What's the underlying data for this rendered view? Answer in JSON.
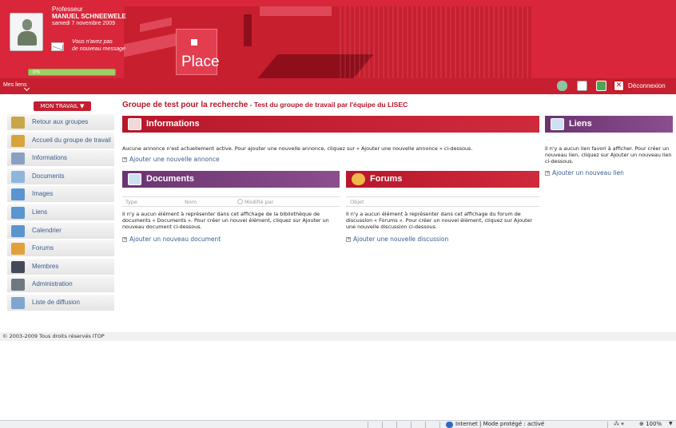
{
  "header": {
    "role": "Professeur",
    "username": "MANUEL SCHNEEWELE",
    "date": "samedi 7 novembre 2009",
    "messages_line1": "Vous n'avez pas",
    "messages_line2": "de nouveau message",
    "progress_label": "0%",
    "progress_fraction": 0,
    "brand": "Place",
    "my_links": "Mes liens",
    "logout": "Déconnexion",
    "icons": [
      "trash-icon",
      "edit-icon",
      "sync-icon",
      "close-icon"
    ]
  },
  "sidebar": {
    "work_menu": "MON TRAVAIL ▼",
    "items": [
      {
        "label": "Retour aux groupes",
        "icon": "back-groups-icon",
        "color": "#c9a64a"
      },
      {
        "label": "Accueil du groupe de travail",
        "icon": "home-icon",
        "color": "#d7a43a"
      },
      {
        "label": "Informations",
        "icon": "info-icon",
        "color": "#8aa0c0"
      },
      {
        "label": "Documents",
        "icon": "folder-icon",
        "color": "#8fb5da"
      },
      {
        "label": "Images",
        "icon": "images-icon",
        "color": "#5a95cf"
      },
      {
        "label": "Liens",
        "icon": "links-icon",
        "color": "#5a95cf"
      },
      {
        "label": "Calendrier",
        "icon": "calendar-icon",
        "color": "#5a95cf"
      },
      {
        "label": "Forums",
        "icon": "forums-icon",
        "color": "#e0a03a"
      },
      {
        "label": "Membres",
        "icon": "members-icon",
        "color": "#444a5a"
      },
      {
        "label": "Administration",
        "icon": "admin-icon",
        "color": "#6e7880"
      },
      {
        "label": "Liste de diffusion",
        "icon": "mailing-list-icon",
        "color": "#7ea6d0"
      }
    ]
  },
  "main": {
    "group_name": "Groupe de test pour la recherche",
    "group_desc": " - Test du groupe de travail par l'équipe du LISEC",
    "informations": {
      "title": "Informations",
      "text": "Aucune annonce n'est actuellement active. Pour ajouter une nouvelle annonce, cliquez sur « Ajouter une nouvelle annonce » ci-dessous.",
      "add": "Ajouter une nouvelle annonce"
    },
    "documents": {
      "title": "Documents",
      "col_type": "Type",
      "col_name": "Nom",
      "col_modified": "Modifié par",
      "text": "Il n'y a aucun élément à représenter dans cet affichage de la bibliothèque de documents « Documents ». Pour créer un nouvel élément, cliquez sur Ajouter un nouveau document ci-dessous.",
      "add": "Ajouter un nouveau document"
    },
    "forums": {
      "title": "Forums",
      "col_subject": "Objet",
      "text": "Il n'y a aucun élément à représenter dans cet affichage du forum de discussion « Forums ». Pour créer un nouvel élément, cliquez sur Ajouter une nouvelle discussion ci-dessous.",
      "add": "Ajouter une nouvelle discussion"
    },
    "liens": {
      "title": "Liens",
      "text": "Il n'y a aucun lien favori à afficher. Pour créer un nouveau lien, cliquez sur Ajouter un nouveau lien ci-dessous.",
      "add": "Ajouter un nouveau lien"
    }
  },
  "footer": {
    "copyright": "© 2003-2009 Tous droits réservés ITOP"
  },
  "statusbar": {
    "zone": "Internet | Mode protégé : activé",
    "zoom": "100%",
    "security": "⁂ ▾"
  },
  "colors": {
    "brand_red": "#d9263a",
    "purple": "#6a3470",
    "link_blue": "#3a5c8e"
  }
}
